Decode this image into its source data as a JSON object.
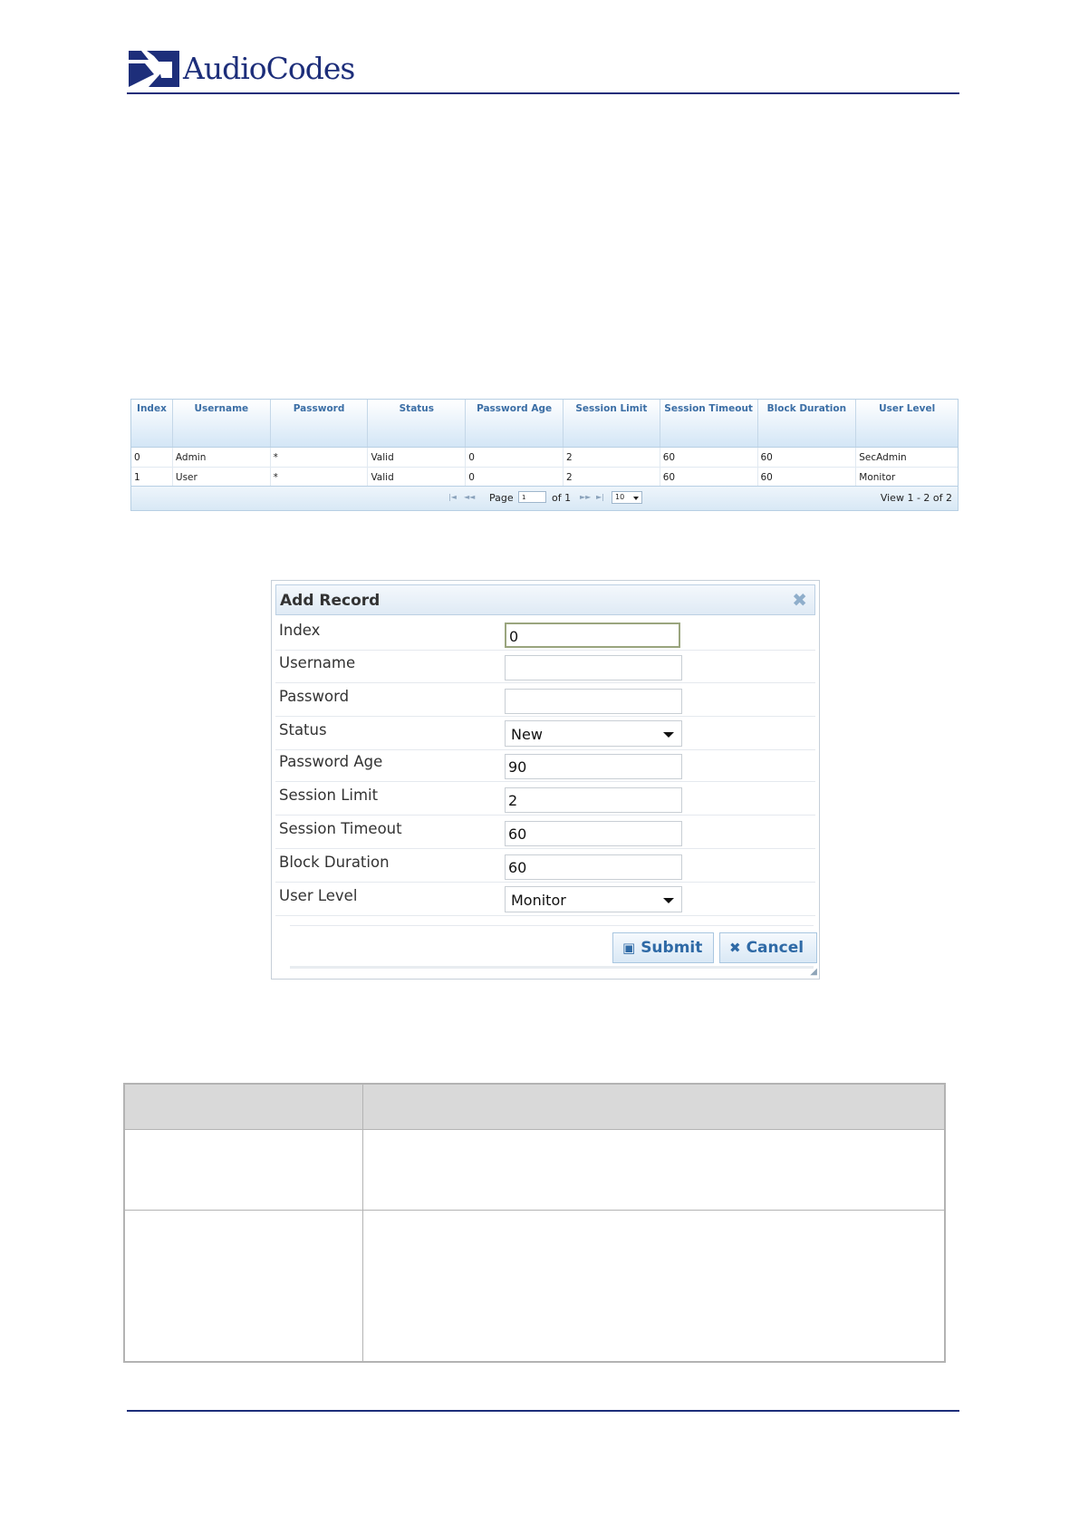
{
  "header": {
    "brand": "AudioCodes"
  },
  "users_table": {
    "columns": [
      "Index",
      "Username",
      "Password",
      "Status",
      "Password Age",
      "Session Limit",
      "Session Timeout",
      "Block Duration",
      "User Level"
    ],
    "rows": [
      [
        "0",
        "Admin",
        "*",
        "Valid",
        "0",
        "2",
        "60",
        "60",
        "SecAdmin"
      ],
      [
        "1",
        "User",
        "*",
        "Valid",
        "0",
        "2",
        "60",
        "60",
        "Monitor"
      ]
    ],
    "pager": {
      "page_label": "Page",
      "page_value": "1",
      "of_label": "of 1",
      "page_size": "10",
      "view_label": "View 1 - 2 of 2"
    }
  },
  "dialog": {
    "title": "Add Record",
    "fields": [
      {
        "label": "Index",
        "value": "0"
      },
      {
        "label": "Username",
        "value": ""
      },
      {
        "label": "Password",
        "value": ""
      },
      {
        "label": "Status",
        "value": "New"
      },
      {
        "label": "Password Age",
        "value": "90"
      },
      {
        "label": "Session Limit",
        "value": "2"
      },
      {
        "label": "Session Timeout",
        "value": "60"
      },
      {
        "label": "Block Duration",
        "value": "60"
      },
      {
        "label": "User Level",
        "value": "Monitor"
      }
    ],
    "submit_label": "Submit",
    "cancel_label": "Cancel"
  },
  "colors": {
    "brand_blue": "#1d2e7a",
    "grid_header_text": "#3b6ea5",
    "button_text": "#2f6aa6"
  }
}
